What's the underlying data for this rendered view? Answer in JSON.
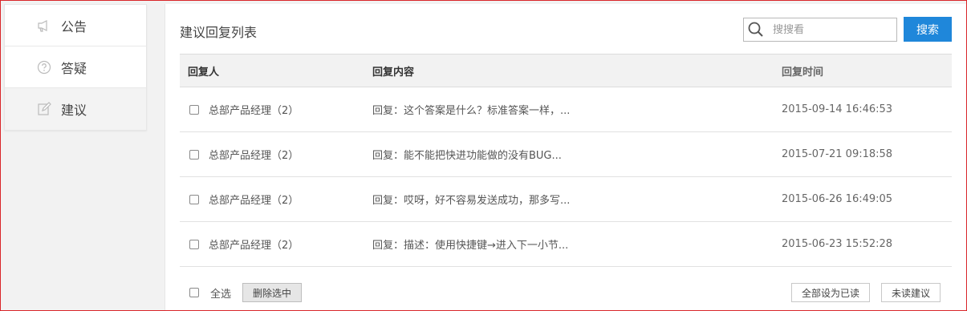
{
  "sidebar": {
    "items": [
      {
        "label": "公告",
        "icon": "megaphone-icon"
      },
      {
        "label": "答疑",
        "icon": "question-circle-icon"
      },
      {
        "label": "建议",
        "icon": "edit-icon",
        "active": true
      }
    ]
  },
  "main": {
    "title": "建议回复列表",
    "search": {
      "placeholder": "搜搜看",
      "value": "",
      "button_label": "搜索"
    },
    "table": {
      "columns": [
        "回复人",
        "回复内容",
        "回复时间"
      ],
      "rows": [
        {
          "user": "总部产品经理（2）",
          "content": "回复：这个答案是什么？标准答案一样，...",
          "time": "2015-09-14 16:46:53"
        },
        {
          "user": "总部产品经理（2）",
          "content": "回复：能不能把快进功能做的没有BUG...",
          "time": "2015-07-21 09:18:58"
        },
        {
          "user": "总部产品经理（2）",
          "content": "回复：哎呀，好不容易发送成功，那多写...",
          "time": "2015-06-26 16:49:05"
        },
        {
          "user": "总部产品经理（2）",
          "content": "回复：描述：使用快捷键→进入下一小节...",
          "time": "2015-06-23 15:52:28"
        }
      ]
    },
    "footer": {
      "select_all_label": "全选",
      "delete_selected_label": "删除选中",
      "mark_all_read_label": "全部设为已读",
      "unread_label": "未读建议"
    }
  },
  "colors": {
    "accent": "#1f87da",
    "frame": "#d9262a"
  }
}
